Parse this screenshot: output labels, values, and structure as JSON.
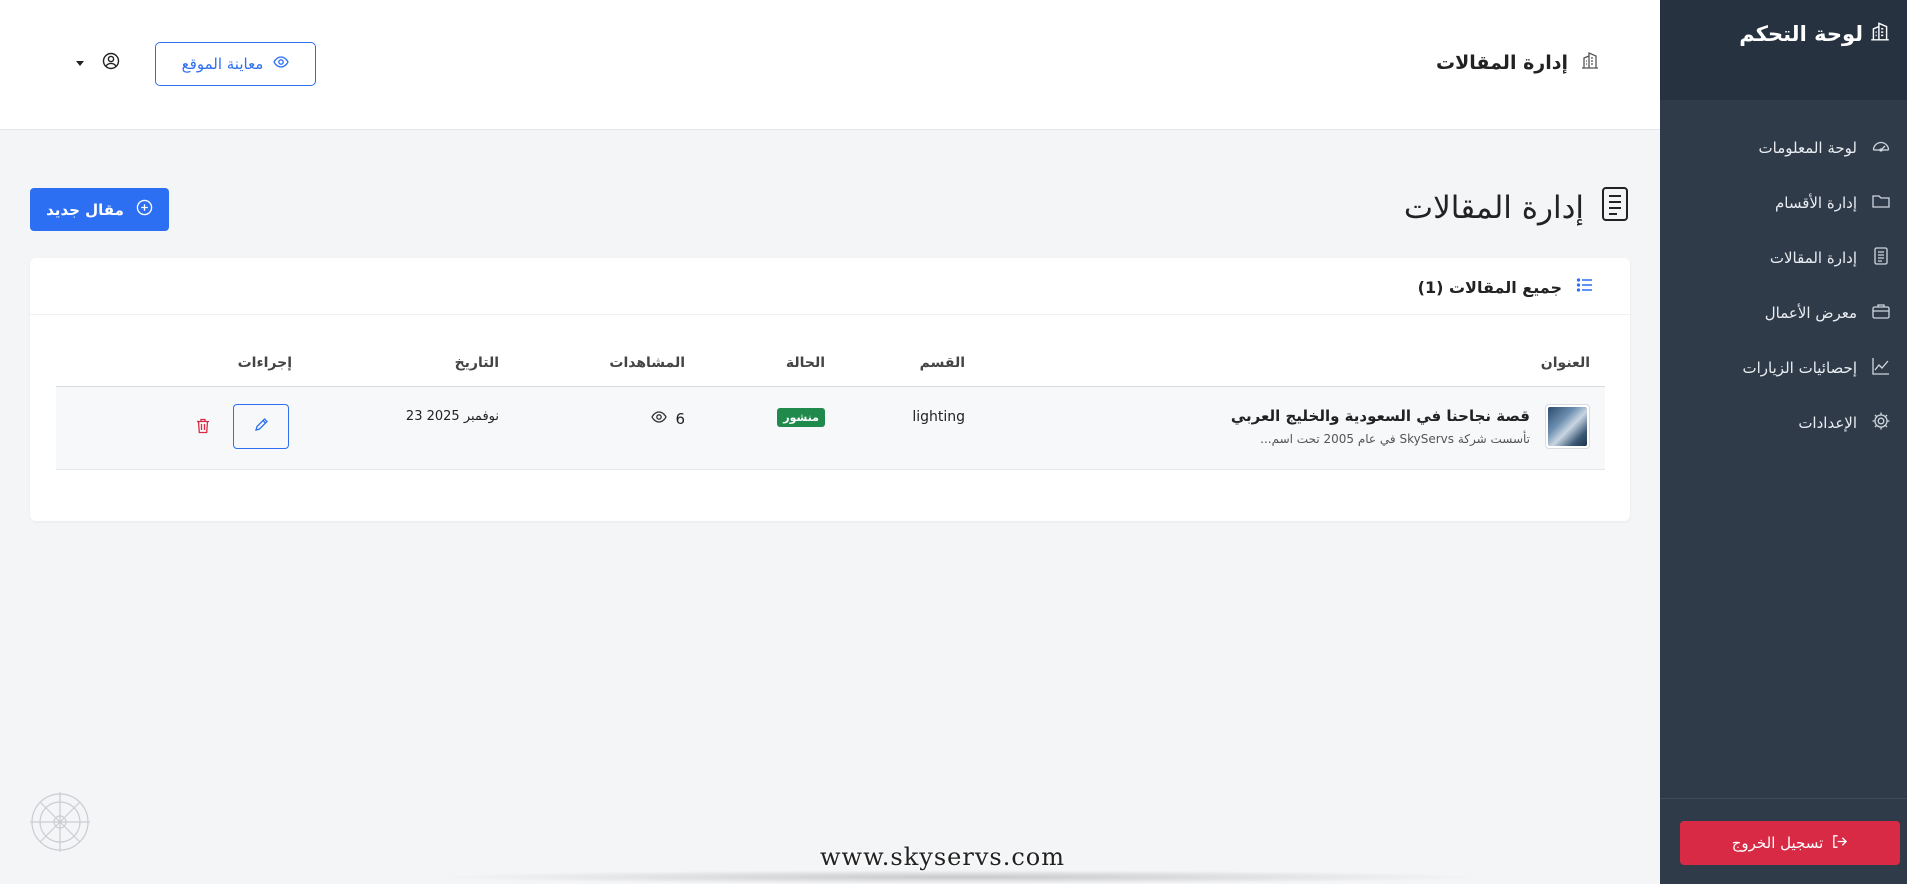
{
  "sidebar": {
    "brand": "لوحة التحكم",
    "items": [
      {
        "label": "لوحة المعلومات",
        "icon": "speedometer-icon"
      },
      {
        "label": "إدارة الأقسام",
        "icon": "folder-icon"
      },
      {
        "label": "إدارة المقالات",
        "icon": "document-icon"
      },
      {
        "label": "معرض الأعمال",
        "icon": "briefcase-icon"
      },
      {
        "label": "إحصائيات الزيارات",
        "icon": "chart-line-icon"
      },
      {
        "label": "الإعدادات",
        "icon": "gear-icon"
      }
    ],
    "logout_label": "تسجيل الخروج"
  },
  "topbar": {
    "title": "إدارة المقالات",
    "preview_label": "معاينة الموقع"
  },
  "page": {
    "heading": "إدارة المقالات",
    "new_article_label": "مقال جديد"
  },
  "card": {
    "title": "جميع المقالات (1)",
    "columns": {
      "title": "العنوان",
      "category": "القسم",
      "status": "الحالة",
      "views": "المشاهدات",
      "date": "التاريخ",
      "actions": "إجراءات"
    },
    "rows": [
      {
        "title": "قصة نجاحنا في السعودية والخليج العربي",
        "excerpt": "تأسست شركة SkyServs في عام 2005 تحت اسم...",
        "category": "lighting",
        "status": "منشور",
        "views": "6",
        "date": "23 نوفمبر 2025"
      }
    ]
  },
  "watermark": "www.skyservs.com",
  "colors": {
    "primary": "#2d6ff2",
    "sidebar": "#2f3b49",
    "danger": "#d82a44",
    "success": "#1f8a4c"
  }
}
